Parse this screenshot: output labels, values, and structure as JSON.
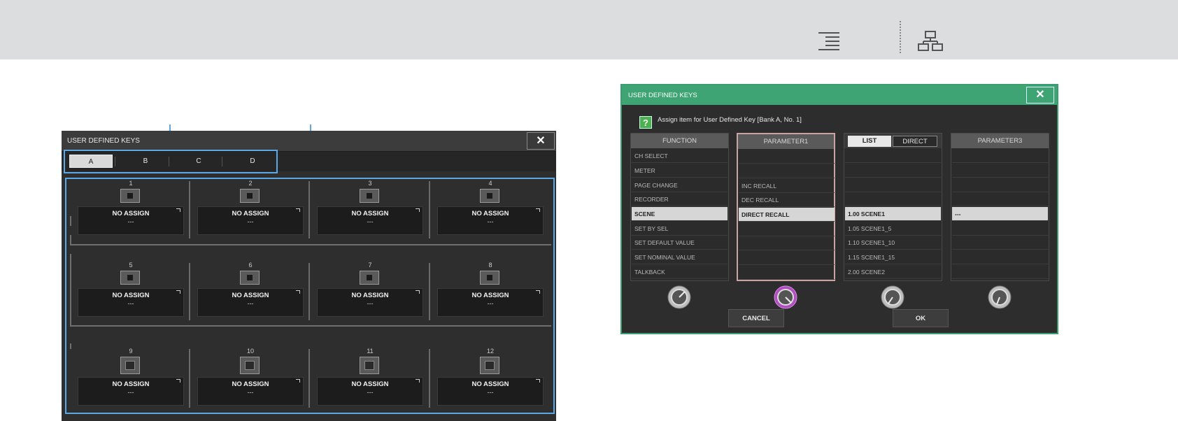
{
  "toolbar": {
    "icons": [
      "align-right-icon",
      "hierarchy-icon"
    ]
  },
  "left_window": {
    "title": "USER DEFINED KEYS",
    "close_label": "✕",
    "bank_tabs": [
      "A",
      "B",
      "C",
      "D"
    ],
    "selected_bank": "A",
    "keys": [
      {
        "number": "1",
        "name": "NO ASSIGN",
        "value": "---"
      },
      {
        "number": "2",
        "name": "NO ASSIGN",
        "value": "---"
      },
      {
        "number": "3",
        "name": "NO ASSIGN",
        "value": "---"
      },
      {
        "number": "4",
        "name": "NO ASSIGN",
        "value": "---"
      },
      {
        "number": "5",
        "name": "NO ASSIGN",
        "value": "---"
      },
      {
        "number": "6",
        "name": "NO ASSIGN",
        "value": "---"
      },
      {
        "number": "7",
        "name": "NO ASSIGN",
        "value": "---"
      },
      {
        "number": "8",
        "name": "NO ASSIGN",
        "value": "---"
      },
      {
        "number": "9",
        "name": "NO ASSIGN",
        "value": "---"
      },
      {
        "number": "10",
        "name": "NO ASSIGN",
        "value": "---"
      },
      {
        "number": "11",
        "name": "NO ASSIGN",
        "value": "---"
      },
      {
        "number": "12",
        "name": "NO ASSIGN",
        "value": "---"
      }
    ]
  },
  "right_window": {
    "title": "USER DEFINED KEYS",
    "close_label": "✕",
    "help_icon": "?",
    "help_text": "Assign item for User Defined Key [Bank A, No. 1]",
    "columns": [
      {
        "header": "FUNCTION",
        "rows": [
          "CH SELECT",
          "METER",
          "PAGE CHANGE",
          "RECORDER",
          "SCENE",
          "SET BY SEL",
          "SET DEFAULT VALUE",
          "SET NOMINAL VALUE",
          "TALKBACK"
        ],
        "selected": 4
      },
      {
        "header": "PARAMETER1",
        "rows": [
          "",
          "",
          "INC RECALL",
          "DEC RECALL",
          "DIRECT RECALL",
          "",
          "",
          "",
          ""
        ],
        "selected": 4
      },
      {
        "header_list": "LIST",
        "header_direct": "DIRECT",
        "rows": [
          "",
          "",
          "",
          "",
          "1.00 SCENE1",
          "1.05 SCENE1_5",
          "1.10 SCENE1_10",
          "1.15 SCENE1_15",
          "2.00 SCENE2"
        ],
        "selected": 4
      },
      {
        "header": "PARAMETER3",
        "rows": [
          "",
          "",
          "",
          "",
          "---",
          "",
          "",
          "",
          ""
        ],
        "selected": 4
      }
    ],
    "cancel_label": "CANCEL",
    "ok_label": "OK",
    "colors": {
      "title_bar": "#3ea473",
      "active_knob": "#b24fc0",
      "selection_border": "#5aa9e6"
    }
  }
}
